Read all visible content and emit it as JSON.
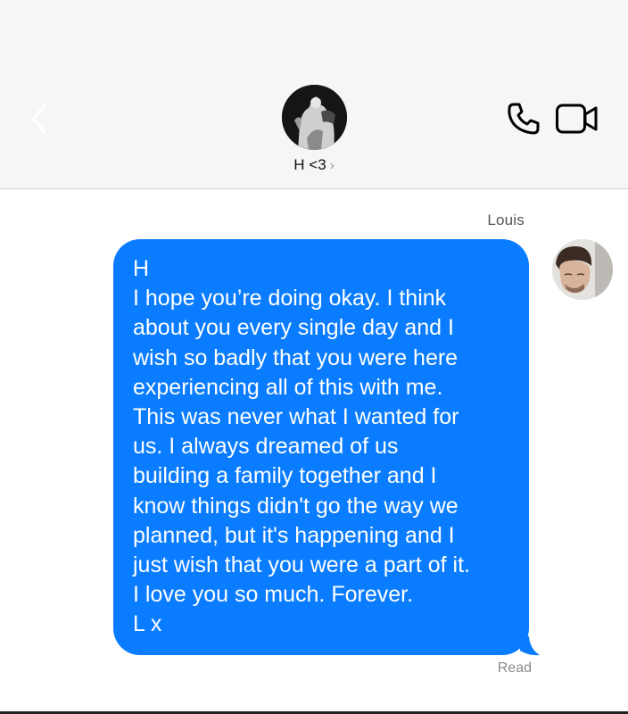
{
  "header": {
    "contact_name": "H <3",
    "chevron": "›",
    "icons": {
      "back": "chevron-left-icon",
      "call": "phone-icon",
      "video": "video-camera-icon"
    }
  },
  "conversation": {
    "sender_name": "Louis",
    "message_lines": [
      "H",
      "I hope you’re doing okay. I think",
      "about you every single day and I",
      "wish so badly that you were here",
      "experiencing all of this with me.",
      "This was never what I wanted for",
      "us. I always dreamed of us",
      "building a family together and I",
      "know things didn't go the way we",
      "planned, but it's happening and I",
      "just wish that you were a part of it.",
      "I love you so much. Forever.",
      "L x"
    ],
    "status": "Read"
  },
  "colors": {
    "bubble": "#0a7cff",
    "header_bg": "#f6f6f6",
    "back_icon": "#ffffff"
  }
}
